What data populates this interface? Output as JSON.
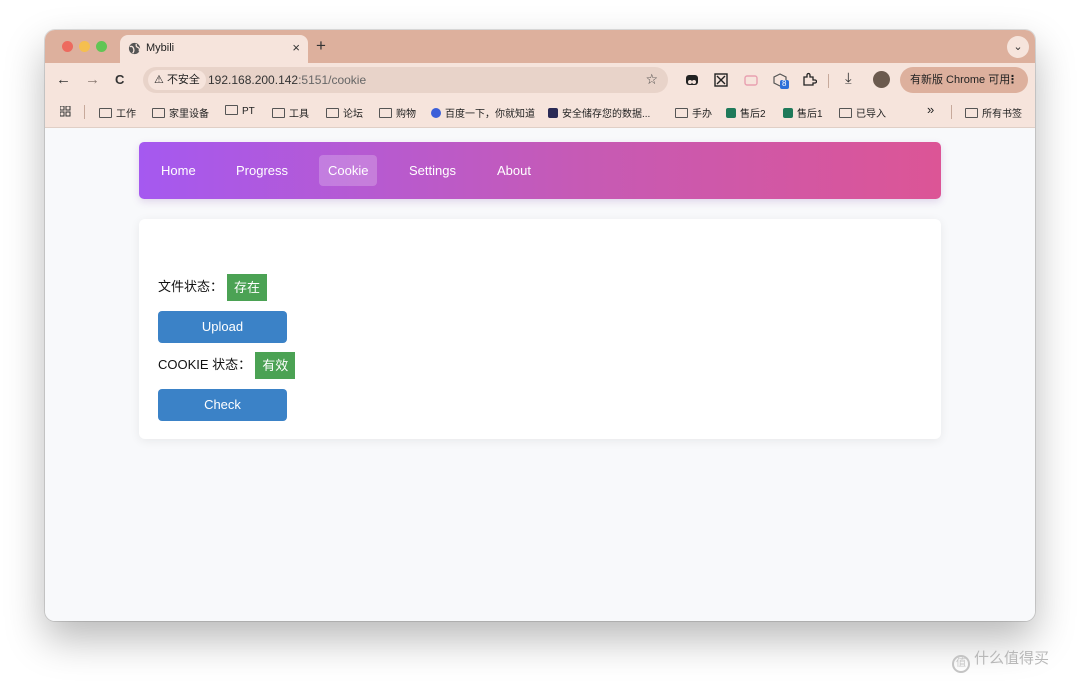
{
  "browser": {
    "tab_title": "Mybili",
    "close_glyph": "×",
    "new_tab_glyph": "+",
    "tab_menu_glyph": "⌄",
    "back_glyph": "←",
    "forward_glyph": "→",
    "reload_glyph": "C",
    "insecure_label": "不安全",
    "url_host": "192.168.200.142",
    "url_path": ":5151/cookie",
    "star_glyph": "☆",
    "update_label": "有新版 Chrome 可用",
    "menu_glyph": "⋮",
    "download_glyph": "⤓",
    "ext_badge": "8"
  },
  "bookmarks": {
    "items": [
      {
        "label": "工作",
        "icon": "folder-icon"
      },
      {
        "label": "家里设备",
        "icon": "folder-icon"
      },
      {
        "label": "PT",
        "icon": "folder-icon"
      },
      {
        "label": "工具",
        "icon": "folder-icon"
      },
      {
        "label": "论坛",
        "icon": "folder-icon"
      },
      {
        "label": "购物",
        "icon": "folder-icon"
      },
      {
        "label": "百度一下，你就知道",
        "icon": "baidu-icon"
      },
      {
        "label": "安全储存您的数据...",
        "icon": "site-icon"
      },
      {
        "label": "手办",
        "icon": "folder-icon"
      },
      {
        "label": "售后2",
        "icon": "sheet-icon"
      },
      {
        "label": "售后1",
        "icon": "sheet-icon"
      },
      {
        "label": "已导入",
        "icon": "folder-icon"
      }
    ],
    "overflow_glyph": "»",
    "all_bookmarks": "所有书签"
  },
  "nav": {
    "items": [
      "Home",
      "Progress",
      "Cookie",
      "Settings",
      "About"
    ],
    "active": "Cookie"
  },
  "content": {
    "file_status_label": "文件状态：",
    "file_status_value": "存在",
    "upload_label": "Upload",
    "cookie_status_label": "COOKIE 状态：",
    "cookie_status_value": "有效",
    "check_label": "Check"
  },
  "watermark": {
    "text": "什么值得买",
    "icon_glyph": "值"
  },
  "colors": {
    "nav_gradient_start": "#a559f0",
    "nav_gradient_end": "#dc5596",
    "badge_green": "#4ba254",
    "button_blue": "#3b82c7",
    "tabstrip": "#ddb09d"
  }
}
